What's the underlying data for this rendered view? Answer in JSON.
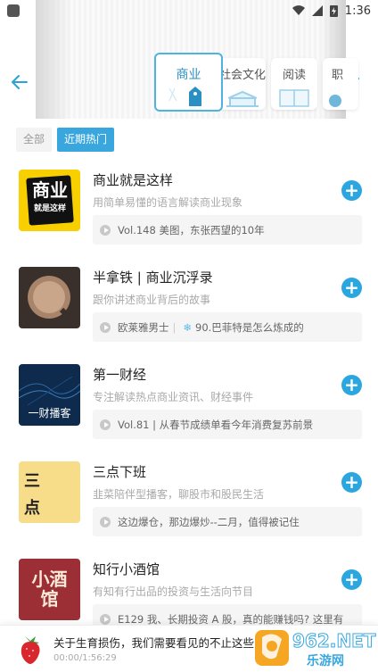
{
  "status_bar": {
    "time": "1:36"
  },
  "categories": [
    {
      "label": "商业",
      "active": true
    },
    {
      "label": "社会文化",
      "active": false
    },
    {
      "label": "阅读",
      "active": false
    },
    {
      "label": "职",
      "active": false
    }
  ],
  "filters": [
    {
      "label": "全部",
      "active": false
    },
    {
      "label": "近期热门",
      "active": true
    }
  ],
  "podcasts": [
    {
      "title": "商业就是这样",
      "desc": "用简单易懂的语言解读商业现象",
      "latest": "Vol.148 美图，东张西望的10年",
      "latest_extra": "",
      "cover_text": "商业",
      "cover_sub": "就是这样"
    },
    {
      "title": "半拿铁 | 商业沉浮录",
      "desc": "跟你讲述商业背后的故事",
      "latest": "欧莱雅男士",
      "latest_extra": "90.巴菲特是怎么炼成的",
      "cover_text": "",
      "cover_sub": ""
    },
    {
      "title": "第一财经",
      "desc": "专注解读热点商业资讯、财经事件",
      "latest": "Vol.81 | 从春节成绩单看今年消费复苏前景",
      "latest_extra": "",
      "cover_text": "一财播客",
      "cover_sub": ""
    },
    {
      "title": "三点下班",
      "desc": "韭菜陪伴型播客，聊股市和股民生活",
      "latest": "这边爆仓，那边爆炒--二月，值得被记住",
      "latest_extra": "",
      "cover_text": "三点下班",
      "cover_sub": ""
    },
    {
      "title": "知行小酒馆",
      "desc": "有知有行出品的投资与生活向节目",
      "latest": "E129 我、长期投资 A 股，真的能赚钱吗? 这里有",
      "latest_extra": "",
      "cover_text": "小酒馆",
      "cover_sub": ""
    }
  ],
  "player": {
    "title": "关于生育损伤，我们需要看见的不止这些......",
    "time": "00:00/1:56:29"
  },
  "watermark": {
    "text": "962.NET",
    "sub": "乐游网"
  },
  "colors": {
    "accent": "#2ba6de",
    "chip_active": "#39a7de"
  }
}
